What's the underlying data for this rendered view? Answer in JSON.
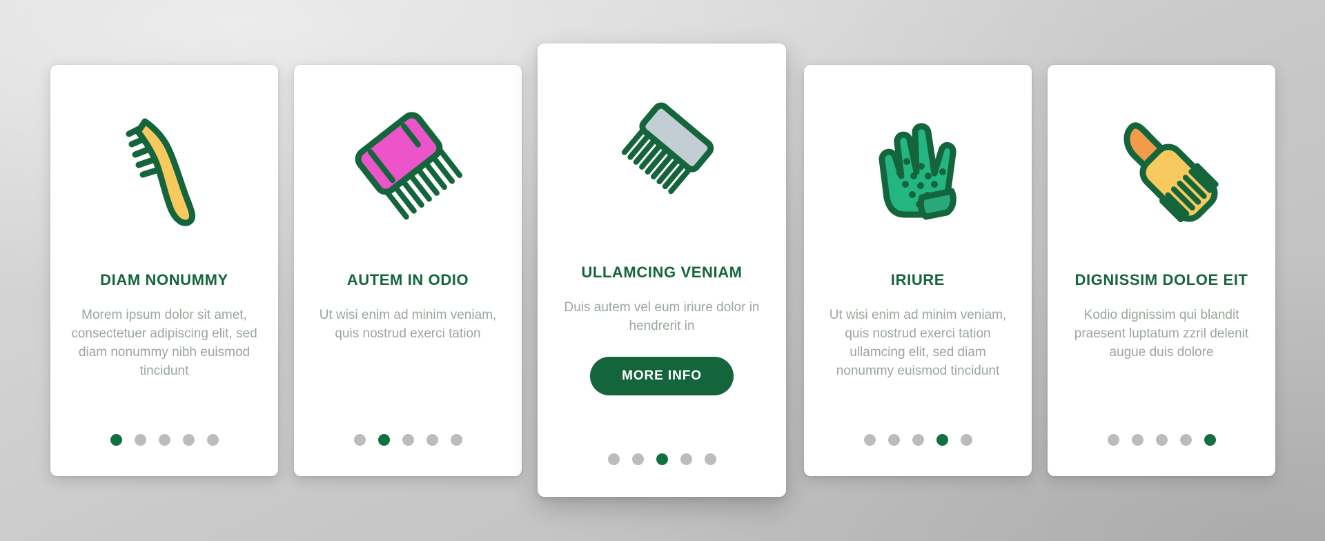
{
  "theme": {
    "background": "#c9c9c9",
    "card_background": "#ffffff",
    "title_color": "#14653c",
    "body_color": "#9aa79a",
    "accent_green": "#14653c",
    "dot_inactive": "#bcbcbc",
    "dot_active": "#11703f",
    "icon_outline": "#14653c",
    "icon_yellow": "#f7c95e",
    "icon_orange": "#f29b4b",
    "icon_pink": "#ec54c9",
    "icon_grey": "#c3cdd4",
    "icon_teal": "#23b682",
    "icon_teal_dark": "#2aa87c"
  },
  "cards": [
    {
      "id": "card-1",
      "variant": "standard",
      "icon": "slicker-brush-icon",
      "title": "DIAM NONUMMY",
      "body": "Morem ipsum dolor sit amet, consectetuer adipiscing elit, sed diam nonummy nibh euismod tincidunt",
      "has_cta": false,
      "cta_label": "",
      "dots": {
        "count": 5,
        "active_index": 0
      }
    },
    {
      "id": "card-2",
      "variant": "standard",
      "icon": "pink-comb-icon",
      "title": "AUTEM IN ODIO",
      "body": "Ut wisi enim ad minim veniam, quis nostrud exerci tation",
      "has_cta": false,
      "cta_label": "",
      "dots": {
        "count": 5,
        "active_index": 1
      }
    },
    {
      "id": "card-3",
      "variant": "featured",
      "icon": "grey-comb-icon",
      "title": "ULLAMCING VENIAM",
      "body": "Duis autem vel eum iriure dolor in hendrerit in",
      "has_cta": true,
      "cta_label": "MORE INFO",
      "dots": {
        "count": 5,
        "active_index": 2
      }
    },
    {
      "id": "card-4",
      "variant": "standard",
      "icon": "grooming-glove-icon",
      "title": "IRIURE",
      "body": "Ut wisi enim ad minim veniam, quis nostrud exerci tation ullamcing elit, sed diam nonummy euismod tincidunt",
      "has_cta": false,
      "cta_label": "",
      "dots": {
        "count": 5,
        "active_index": 3
      }
    },
    {
      "id": "card-5",
      "variant": "standard",
      "icon": "rake-brush-icon",
      "title": "DIGNISSIM DOLOE EIT",
      "body": "Kodio dignissim qui blandit praesent luptatum zzril delenit augue duis dolore",
      "has_cta": false,
      "cta_label": "",
      "dots": {
        "count": 5,
        "active_index": 4
      }
    }
  ]
}
